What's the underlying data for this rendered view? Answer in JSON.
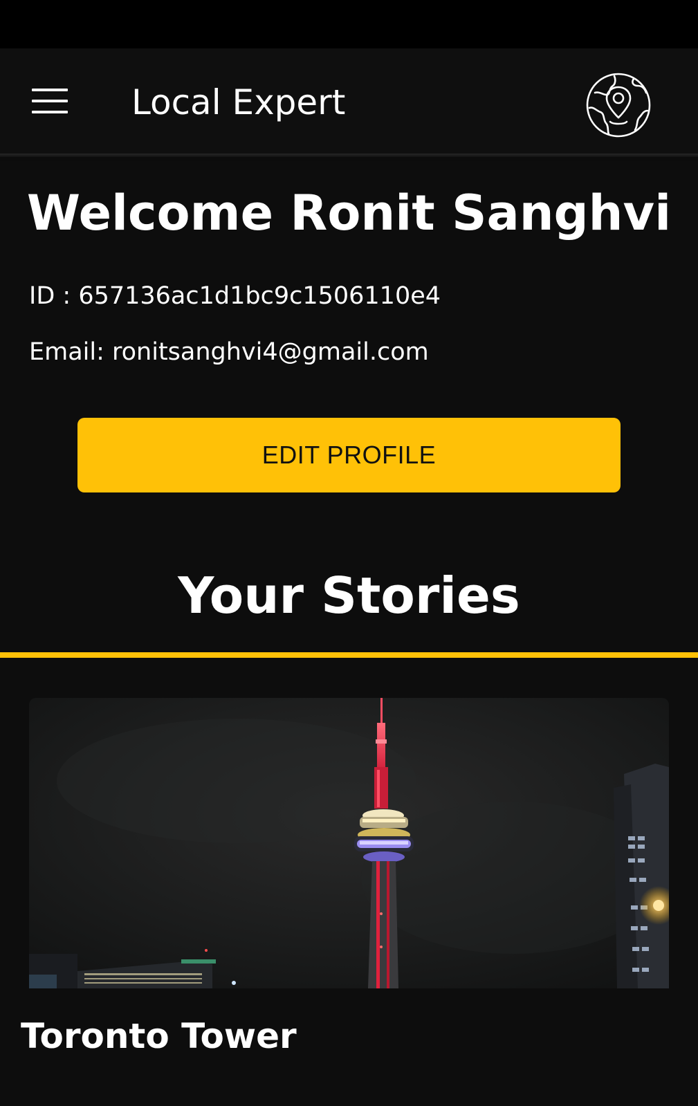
{
  "app_bar": {
    "title": "Local Expert",
    "menu_icon": "hamburger-menu-icon",
    "location_icon": "globe-location-pin-icon"
  },
  "profile": {
    "welcome_text": "Welcome Ronit Sanghvi",
    "id_text": "ID : 657136ac1d1bc9c1506110e4",
    "email_text": "Email: ronitsanghvi4@gmail.com",
    "edit_button_label": "EDIT PROFILE"
  },
  "stories": {
    "heading": "Your Stories",
    "items": [
      {
        "title": "Toronto Tower",
        "image_description_icon": "cn-tower-night-photo"
      }
    ]
  },
  "colors": {
    "background": "#0d0d0d",
    "accent": "#ffc107",
    "text": "#ffffff",
    "status_bar": "#000000"
  }
}
